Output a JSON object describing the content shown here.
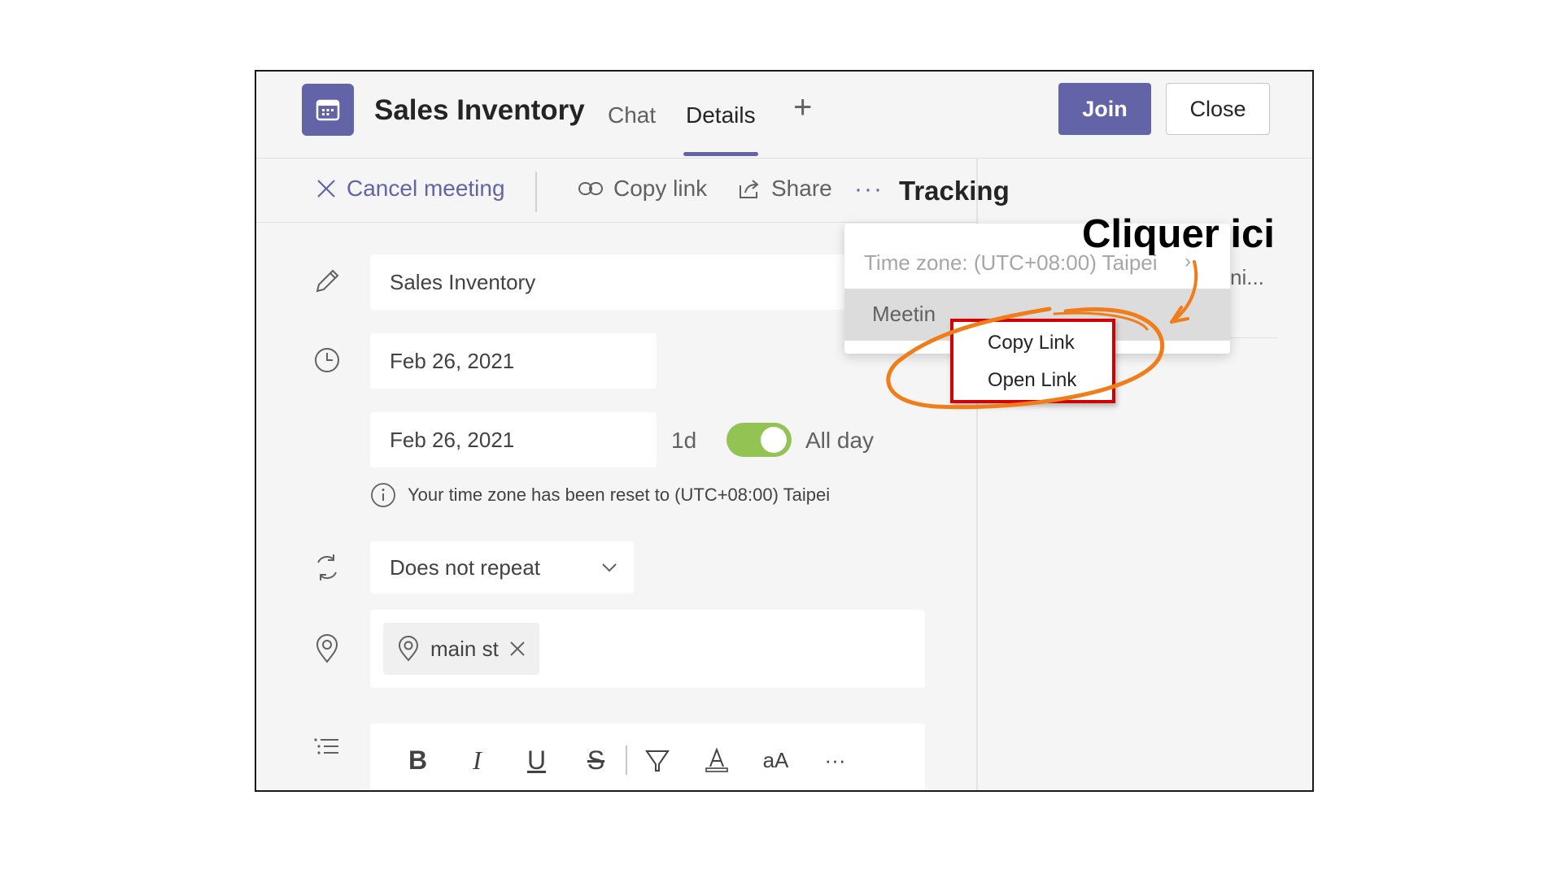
{
  "header": {
    "title": "Sales Inventory",
    "tabs": [
      {
        "label": "Chat"
      },
      {
        "label": "Details"
      }
    ],
    "join_label": "Join",
    "close_label": "Close"
  },
  "toolbar": {
    "cancel_label": "Cancel meeting",
    "copy_link_label": "Copy link",
    "share_label": "Share",
    "more_label": "···"
  },
  "tracking": {
    "title": "Tracking",
    "truncated_text": "ni..."
  },
  "form": {
    "title_value": "Sales Inventory",
    "start_date": "Feb 26, 2021",
    "end_date": "Feb 26, 2021",
    "duration": "1d",
    "all_day_label": "All day",
    "timezone_note": "Your time zone has been reset to (UTC+08:00) Taipei",
    "repeat_value": "Does not repeat",
    "location_chip": "main st"
  },
  "editor": {
    "font_size_label": "aA",
    "more_label": "···"
  },
  "menu": {
    "timezone_item": "Time zone: (UTC+08:00) Taipei",
    "meeting_item_visible": "Meetin"
  },
  "submenu": {
    "items": [
      {
        "label": "Copy Link"
      },
      {
        "label": "Open Link"
      }
    ]
  },
  "annotation": {
    "callout_text": "Cliquer ici"
  },
  "colors": {
    "accent": "#6264a7",
    "toggle_on": "#92c353",
    "highlight_box": "#d30000",
    "annotation": "#f07c1a"
  }
}
